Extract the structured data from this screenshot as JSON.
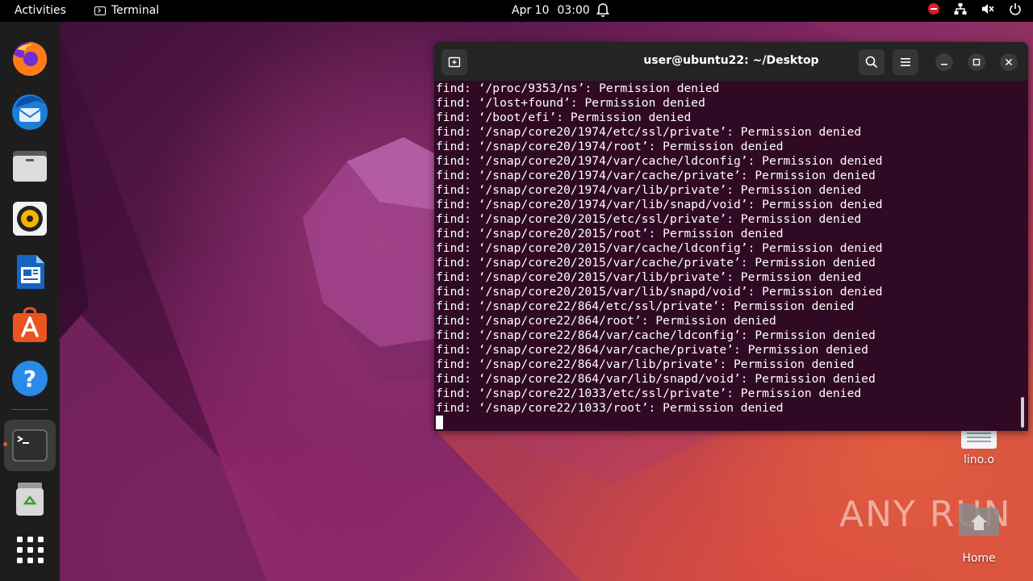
{
  "topbar": {
    "activities": "Activities",
    "app_name": "Terminal",
    "date": "Apr 10",
    "time": "03:00"
  },
  "dock": {
    "items": [
      {
        "name": "firefox-icon"
      },
      {
        "name": "thunderbird-icon"
      },
      {
        "name": "files-icon"
      },
      {
        "name": "rhythmbox-icon"
      },
      {
        "name": "libreoffice-writer-icon"
      },
      {
        "name": "ubuntu-software-icon"
      },
      {
        "name": "help-icon"
      },
      {
        "name": "terminal-icon"
      },
      {
        "name": "trash-icon"
      },
      {
        "name": "show-applications-icon"
      }
    ]
  },
  "desktop": {
    "file_label": "lino.o",
    "home_label": "Home",
    "watermark": "ANY RUN"
  },
  "terminal": {
    "title": "user@ubuntu22: ~/Desktop",
    "lines": [
      "find: ‘/proc/9353/ns’: Permission denied",
      "find: ‘/lost+found’: Permission denied",
      "find: ‘/boot/efi’: Permission denied",
      "find: ‘/snap/core20/1974/etc/ssl/private’: Permission denied",
      "find: ‘/snap/core20/1974/root’: Permission denied",
      "find: ‘/snap/core20/1974/var/cache/ldconfig’: Permission denied",
      "find: ‘/snap/core20/1974/var/cache/private’: Permission denied",
      "find: ‘/snap/core20/1974/var/lib/private’: Permission denied",
      "find: ‘/snap/core20/1974/var/lib/snapd/void’: Permission denied",
      "find: ‘/snap/core20/2015/etc/ssl/private’: Permission denied",
      "find: ‘/snap/core20/2015/root’: Permission denied",
      "find: ‘/snap/core20/2015/var/cache/ldconfig’: Permission denied",
      "find: ‘/snap/core20/2015/var/cache/private’: Permission denied",
      "find: ‘/snap/core20/2015/var/lib/private’: Permission denied",
      "find: ‘/snap/core20/2015/var/lib/snapd/void’: Permission denied",
      "find: ‘/snap/core22/864/etc/ssl/private’: Permission denied",
      "find: ‘/snap/core22/864/root’: Permission denied",
      "find: ‘/snap/core22/864/var/cache/ldconfig’: Permission denied",
      "find: ‘/snap/core22/864/var/cache/private’: Permission denied",
      "find: ‘/snap/core22/864/var/lib/private’: Permission denied",
      "find: ‘/snap/core22/864/var/lib/snapd/void’: Permission denied",
      "find: ‘/snap/core22/1033/etc/ssl/private’: Permission denied",
      "find: ‘/snap/core22/1033/root’: Permission denied"
    ]
  },
  "colors": {
    "terminal_bg": "#300a24",
    "titlebar_bg": "#242424",
    "accent": "#e95420"
  }
}
